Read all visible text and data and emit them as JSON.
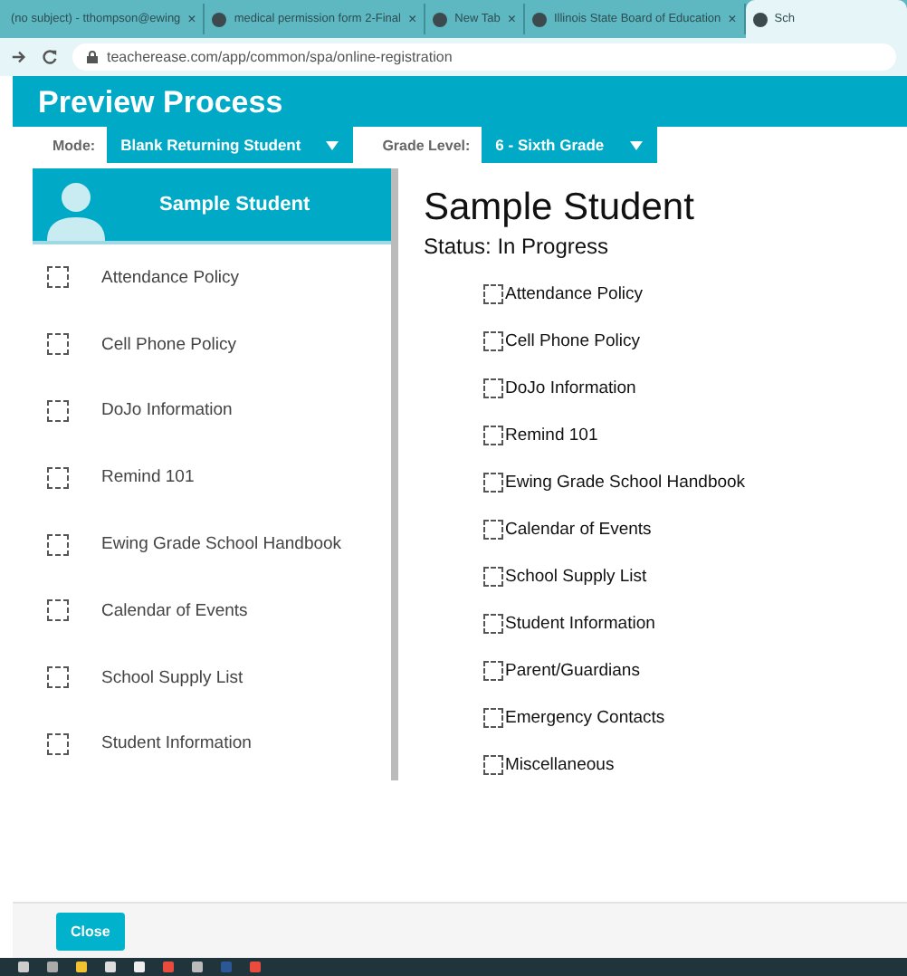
{
  "browser": {
    "tabs": [
      {
        "title": "(no subject) - tthompson@ewing",
        "selected": false,
        "close": "×"
      },
      {
        "title": "medical permission form 2-Final",
        "selected": false,
        "close": "×"
      },
      {
        "title": "New Tab",
        "selected": false,
        "close": "×"
      },
      {
        "title": "Illinois State Board of Education",
        "selected": false,
        "close": "×"
      },
      {
        "title": "Sch",
        "selected": true
      }
    ],
    "url": "teacherease.com/app/common/spa/online-registration"
  },
  "header": {
    "title": "Preview Process"
  },
  "filters": [
    {
      "label": "Mode:",
      "value": "Blank Returning Student"
    },
    {
      "label": "Grade Level:",
      "value": "6 - Sixth Grade"
    }
  ],
  "sidebar": {
    "student": "Sample Student",
    "items": [
      {
        "label": "Attendance Policy",
        "checked": false
      },
      {
        "label": "Cell Phone Policy",
        "checked": false
      },
      {
        "label": "DoJo Information",
        "checked": false
      },
      {
        "label": "Remind 101",
        "checked": false
      },
      {
        "label": "Ewing Grade School Handbook",
        "checked": false
      },
      {
        "label": "Calendar of Events",
        "checked": false
      },
      {
        "label": "School Supply List",
        "checked": false
      },
      {
        "label": "Student Information",
        "checked": false
      }
    ]
  },
  "main": {
    "title": "Sample Student",
    "status": "Status: In Progress",
    "items": [
      {
        "label": "Attendance Policy",
        "checked": false
      },
      {
        "label": "Cell Phone Policy",
        "checked": false
      },
      {
        "label": "DoJo Information",
        "checked": false
      },
      {
        "label": "Remind 101",
        "checked": false
      },
      {
        "label": "Ewing Grade School Handbook",
        "checked": false
      },
      {
        "label": "Calendar of Events",
        "checked": false
      },
      {
        "label": "School Supply List",
        "checked": false
      },
      {
        "label": "Student Information",
        "checked": false
      },
      {
        "label": "Parent/Guardians",
        "checked": false
      },
      {
        "label": "Emergency Contacts",
        "checked": false
      },
      {
        "label": "Miscellaneous",
        "checked": false
      }
    ]
  },
  "footer": {
    "button": "Close"
  }
}
